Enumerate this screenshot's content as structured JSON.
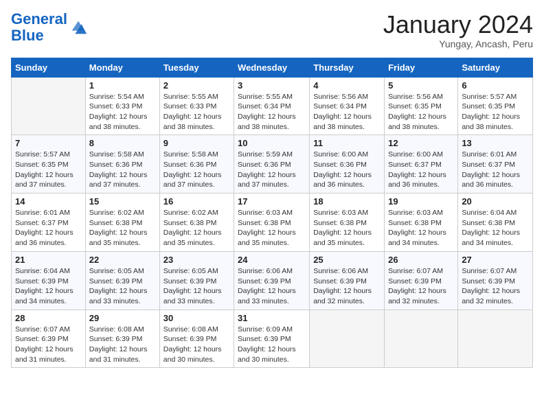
{
  "header": {
    "logo_line1": "General",
    "logo_line2": "Blue",
    "month_title": "January 2024",
    "subtitle": "Yungay, Ancash, Peru"
  },
  "days_of_week": [
    "Sunday",
    "Monday",
    "Tuesday",
    "Wednesday",
    "Thursday",
    "Friday",
    "Saturday"
  ],
  "weeks": [
    [
      {
        "day": "",
        "info": ""
      },
      {
        "day": "1",
        "info": "Sunrise: 5:54 AM\nSunset: 6:33 PM\nDaylight: 12 hours\nand 38 minutes."
      },
      {
        "day": "2",
        "info": "Sunrise: 5:55 AM\nSunset: 6:33 PM\nDaylight: 12 hours\nand 38 minutes."
      },
      {
        "day": "3",
        "info": "Sunrise: 5:55 AM\nSunset: 6:34 PM\nDaylight: 12 hours\nand 38 minutes."
      },
      {
        "day": "4",
        "info": "Sunrise: 5:56 AM\nSunset: 6:34 PM\nDaylight: 12 hours\nand 38 minutes."
      },
      {
        "day": "5",
        "info": "Sunrise: 5:56 AM\nSunset: 6:35 PM\nDaylight: 12 hours\nand 38 minutes."
      },
      {
        "day": "6",
        "info": "Sunrise: 5:57 AM\nSunset: 6:35 PM\nDaylight: 12 hours\nand 38 minutes."
      }
    ],
    [
      {
        "day": "7",
        "info": "Sunrise: 5:57 AM\nSunset: 6:35 PM\nDaylight: 12 hours\nand 37 minutes."
      },
      {
        "day": "8",
        "info": "Sunrise: 5:58 AM\nSunset: 6:36 PM\nDaylight: 12 hours\nand 37 minutes."
      },
      {
        "day": "9",
        "info": "Sunrise: 5:58 AM\nSunset: 6:36 PM\nDaylight: 12 hours\nand 37 minutes."
      },
      {
        "day": "10",
        "info": "Sunrise: 5:59 AM\nSunset: 6:36 PM\nDaylight: 12 hours\nand 37 minutes."
      },
      {
        "day": "11",
        "info": "Sunrise: 6:00 AM\nSunset: 6:36 PM\nDaylight: 12 hours\nand 36 minutes."
      },
      {
        "day": "12",
        "info": "Sunrise: 6:00 AM\nSunset: 6:37 PM\nDaylight: 12 hours\nand 36 minutes."
      },
      {
        "day": "13",
        "info": "Sunrise: 6:01 AM\nSunset: 6:37 PM\nDaylight: 12 hours\nand 36 minutes."
      }
    ],
    [
      {
        "day": "14",
        "info": "Sunrise: 6:01 AM\nSunset: 6:37 PM\nDaylight: 12 hours\nand 36 minutes."
      },
      {
        "day": "15",
        "info": "Sunrise: 6:02 AM\nSunset: 6:38 PM\nDaylight: 12 hours\nand 35 minutes."
      },
      {
        "day": "16",
        "info": "Sunrise: 6:02 AM\nSunset: 6:38 PM\nDaylight: 12 hours\nand 35 minutes."
      },
      {
        "day": "17",
        "info": "Sunrise: 6:03 AM\nSunset: 6:38 PM\nDaylight: 12 hours\nand 35 minutes."
      },
      {
        "day": "18",
        "info": "Sunrise: 6:03 AM\nSunset: 6:38 PM\nDaylight: 12 hours\nand 35 minutes."
      },
      {
        "day": "19",
        "info": "Sunrise: 6:03 AM\nSunset: 6:38 PM\nDaylight: 12 hours\nand 34 minutes."
      },
      {
        "day": "20",
        "info": "Sunrise: 6:04 AM\nSunset: 6:38 PM\nDaylight: 12 hours\nand 34 minutes."
      }
    ],
    [
      {
        "day": "21",
        "info": "Sunrise: 6:04 AM\nSunset: 6:39 PM\nDaylight: 12 hours\nand 34 minutes."
      },
      {
        "day": "22",
        "info": "Sunrise: 6:05 AM\nSunset: 6:39 PM\nDaylight: 12 hours\nand 33 minutes."
      },
      {
        "day": "23",
        "info": "Sunrise: 6:05 AM\nSunset: 6:39 PM\nDaylight: 12 hours\nand 33 minutes."
      },
      {
        "day": "24",
        "info": "Sunrise: 6:06 AM\nSunset: 6:39 PM\nDaylight: 12 hours\nand 33 minutes."
      },
      {
        "day": "25",
        "info": "Sunrise: 6:06 AM\nSunset: 6:39 PM\nDaylight: 12 hours\nand 32 minutes."
      },
      {
        "day": "26",
        "info": "Sunrise: 6:07 AM\nSunset: 6:39 PM\nDaylight: 12 hours\nand 32 minutes."
      },
      {
        "day": "27",
        "info": "Sunrise: 6:07 AM\nSunset: 6:39 PM\nDaylight: 12 hours\nand 32 minutes."
      }
    ],
    [
      {
        "day": "28",
        "info": "Sunrise: 6:07 AM\nSunset: 6:39 PM\nDaylight: 12 hours\nand 31 minutes."
      },
      {
        "day": "29",
        "info": "Sunrise: 6:08 AM\nSunset: 6:39 PM\nDaylight: 12 hours\nand 31 minutes."
      },
      {
        "day": "30",
        "info": "Sunrise: 6:08 AM\nSunset: 6:39 PM\nDaylight: 12 hours\nand 30 minutes."
      },
      {
        "day": "31",
        "info": "Sunrise: 6:09 AM\nSunset: 6:39 PM\nDaylight: 12 hours\nand 30 minutes."
      },
      {
        "day": "",
        "info": ""
      },
      {
        "day": "",
        "info": ""
      },
      {
        "day": "",
        "info": ""
      }
    ]
  ]
}
